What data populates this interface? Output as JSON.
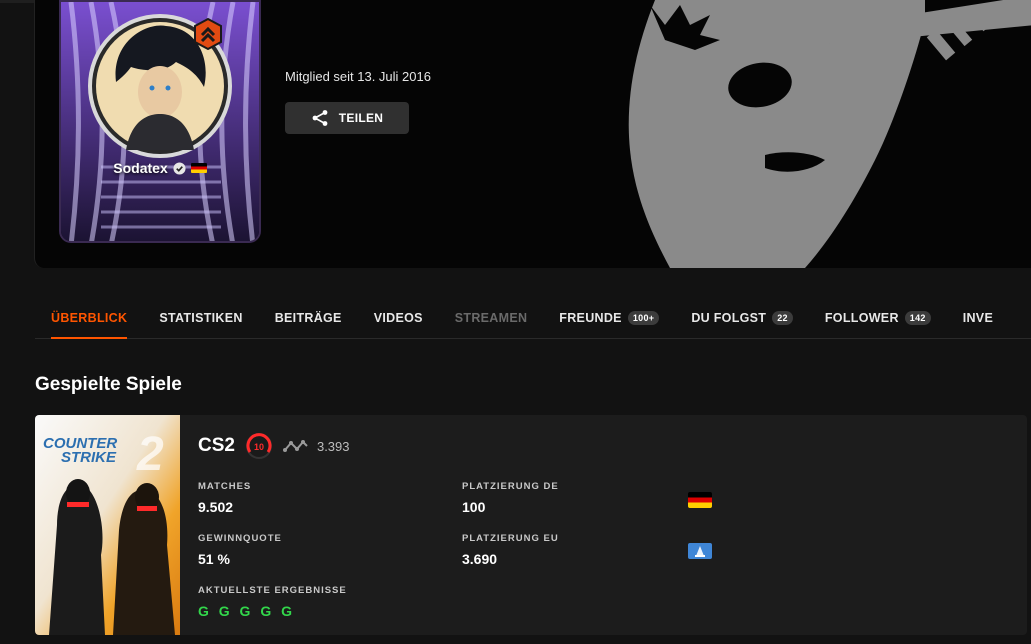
{
  "profile": {
    "username": "Sodatex",
    "member_since": "Mitglied seit 13. Juli 2016",
    "share_label": "TEILEN"
  },
  "tabs": [
    {
      "label": "ÜBERBLICK",
      "count": null,
      "state": "active"
    },
    {
      "label": "STATISTIKEN",
      "count": null,
      "state": "normal"
    },
    {
      "label": "BEITRÄGE",
      "count": null,
      "state": "normal"
    },
    {
      "label": "VIDEOS",
      "count": null,
      "state": "normal"
    },
    {
      "label": "STREAMEN",
      "count": null,
      "state": "disabled"
    },
    {
      "label": "FREUNDE",
      "count": "100+",
      "state": "normal"
    },
    {
      "label": "DU FOLGST",
      "count": "22",
      "state": "normal"
    },
    {
      "label": "FOLLOWER",
      "count": "142",
      "state": "normal"
    },
    {
      "label": "INVE",
      "count": null,
      "state": "normal"
    }
  ],
  "section": {
    "title": "Gespielte Spiele"
  },
  "game": {
    "cover_text_line1": "COUNTER",
    "cover_text_line2": "STRIKE",
    "cover_number": "2",
    "title": "CS2",
    "level": "10",
    "elo": "3.393",
    "matches_label": "MATCHES",
    "matches_value": "9.502",
    "winrate_label": "GEWINNQUOTE",
    "winrate_value": "51 %",
    "recent_label": "AKTUELLSTE ERGEBNISSE",
    "recent_value": "G G G G G",
    "rank_de_label": "PLATZIERUNG DE",
    "rank_de_value": "100",
    "rank_eu_label": "PLATZIERUNG EU",
    "rank_eu_value": "3.690"
  },
  "colors": {
    "accent": "#ff5500",
    "win": "#32d74b",
    "background": "#121212",
    "card": "#1c1c1c"
  },
  "icons": [
    "chevron-up-badge-icon",
    "verified-icon",
    "flag-de-icon",
    "share-icon",
    "elo-trend-icon",
    "level-10-icon",
    "eu-icon"
  ]
}
